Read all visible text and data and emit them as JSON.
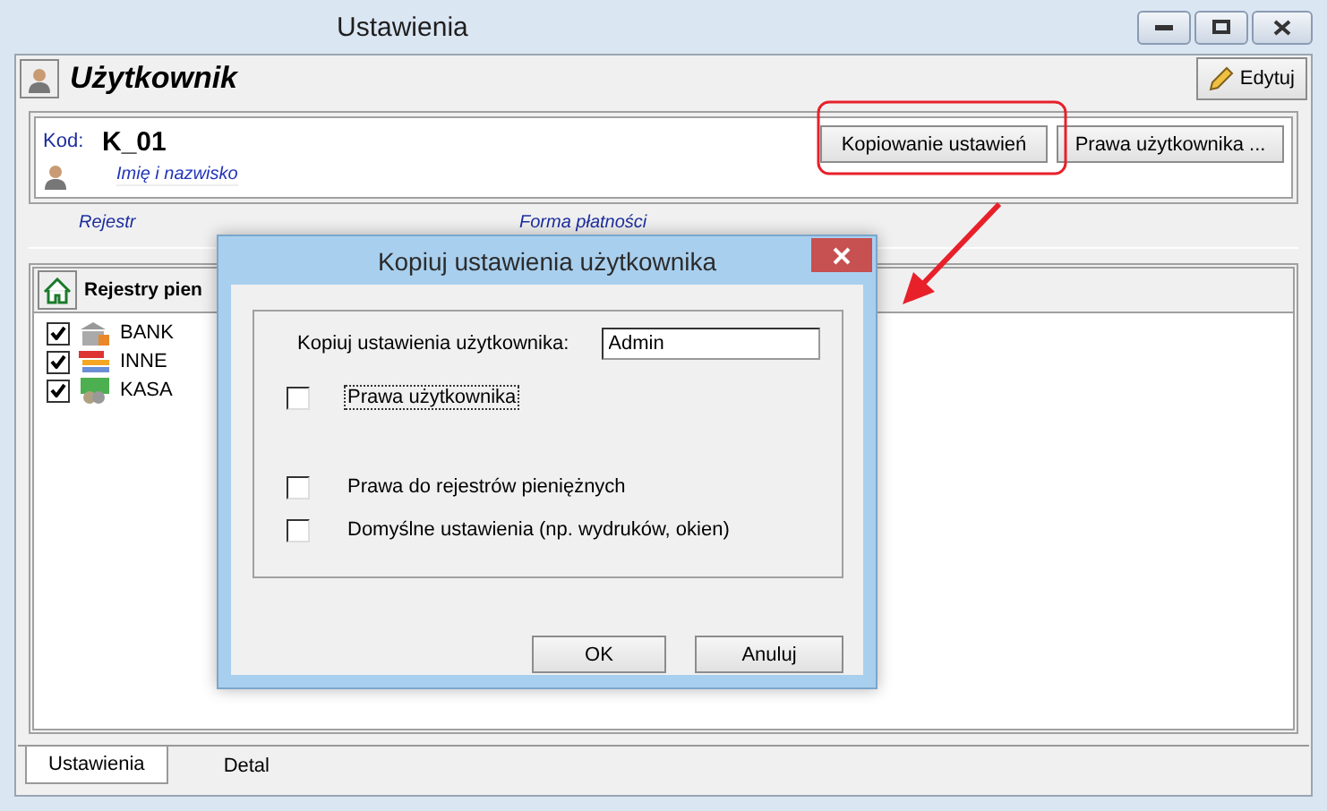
{
  "window": {
    "title": "Ustawienia"
  },
  "header": {
    "title": "Użytkownik",
    "edit_button": "Edytuj"
  },
  "user": {
    "code_label": "Kod:",
    "code": "K_01",
    "name_placeholder": "Imię i nazwisko"
  },
  "actions": [
    "Kopiowanie ustawień",
    "Prawa użytkownika ..."
  ],
  "columns": [
    "Rejestr",
    "Forma płatności"
  ],
  "registers": {
    "title": "Rejestry pien",
    "items": [
      {
        "label": "BANK",
        "checked": true,
        "kind": "bank"
      },
      {
        "label": "INNE",
        "checked": true,
        "kind": "card"
      },
      {
        "label": "KASA",
        "checked": true,
        "kind": "cash"
      }
    ]
  },
  "tabs": [
    {
      "label": "Ustawienia",
      "selected": true
    },
    {
      "label": "Detal",
      "selected": false
    }
  ],
  "dialog": {
    "title": "Kopiuj ustawienia użytkownika",
    "source_label": "Kopiuj ustawienia użytkownika:",
    "source_value": "Admin",
    "options": [
      {
        "label": "Prawa użytkownika",
        "checked": false,
        "focused": true
      },
      {
        "label": "Prawa do rejestrów pieniężnych",
        "checked": false,
        "focused": false
      },
      {
        "label": "Domyślne ustawienia (np. wydruków, okien)",
        "checked": false,
        "focused": false
      }
    ],
    "buttons": [
      "OK",
      "Anuluj"
    ]
  }
}
